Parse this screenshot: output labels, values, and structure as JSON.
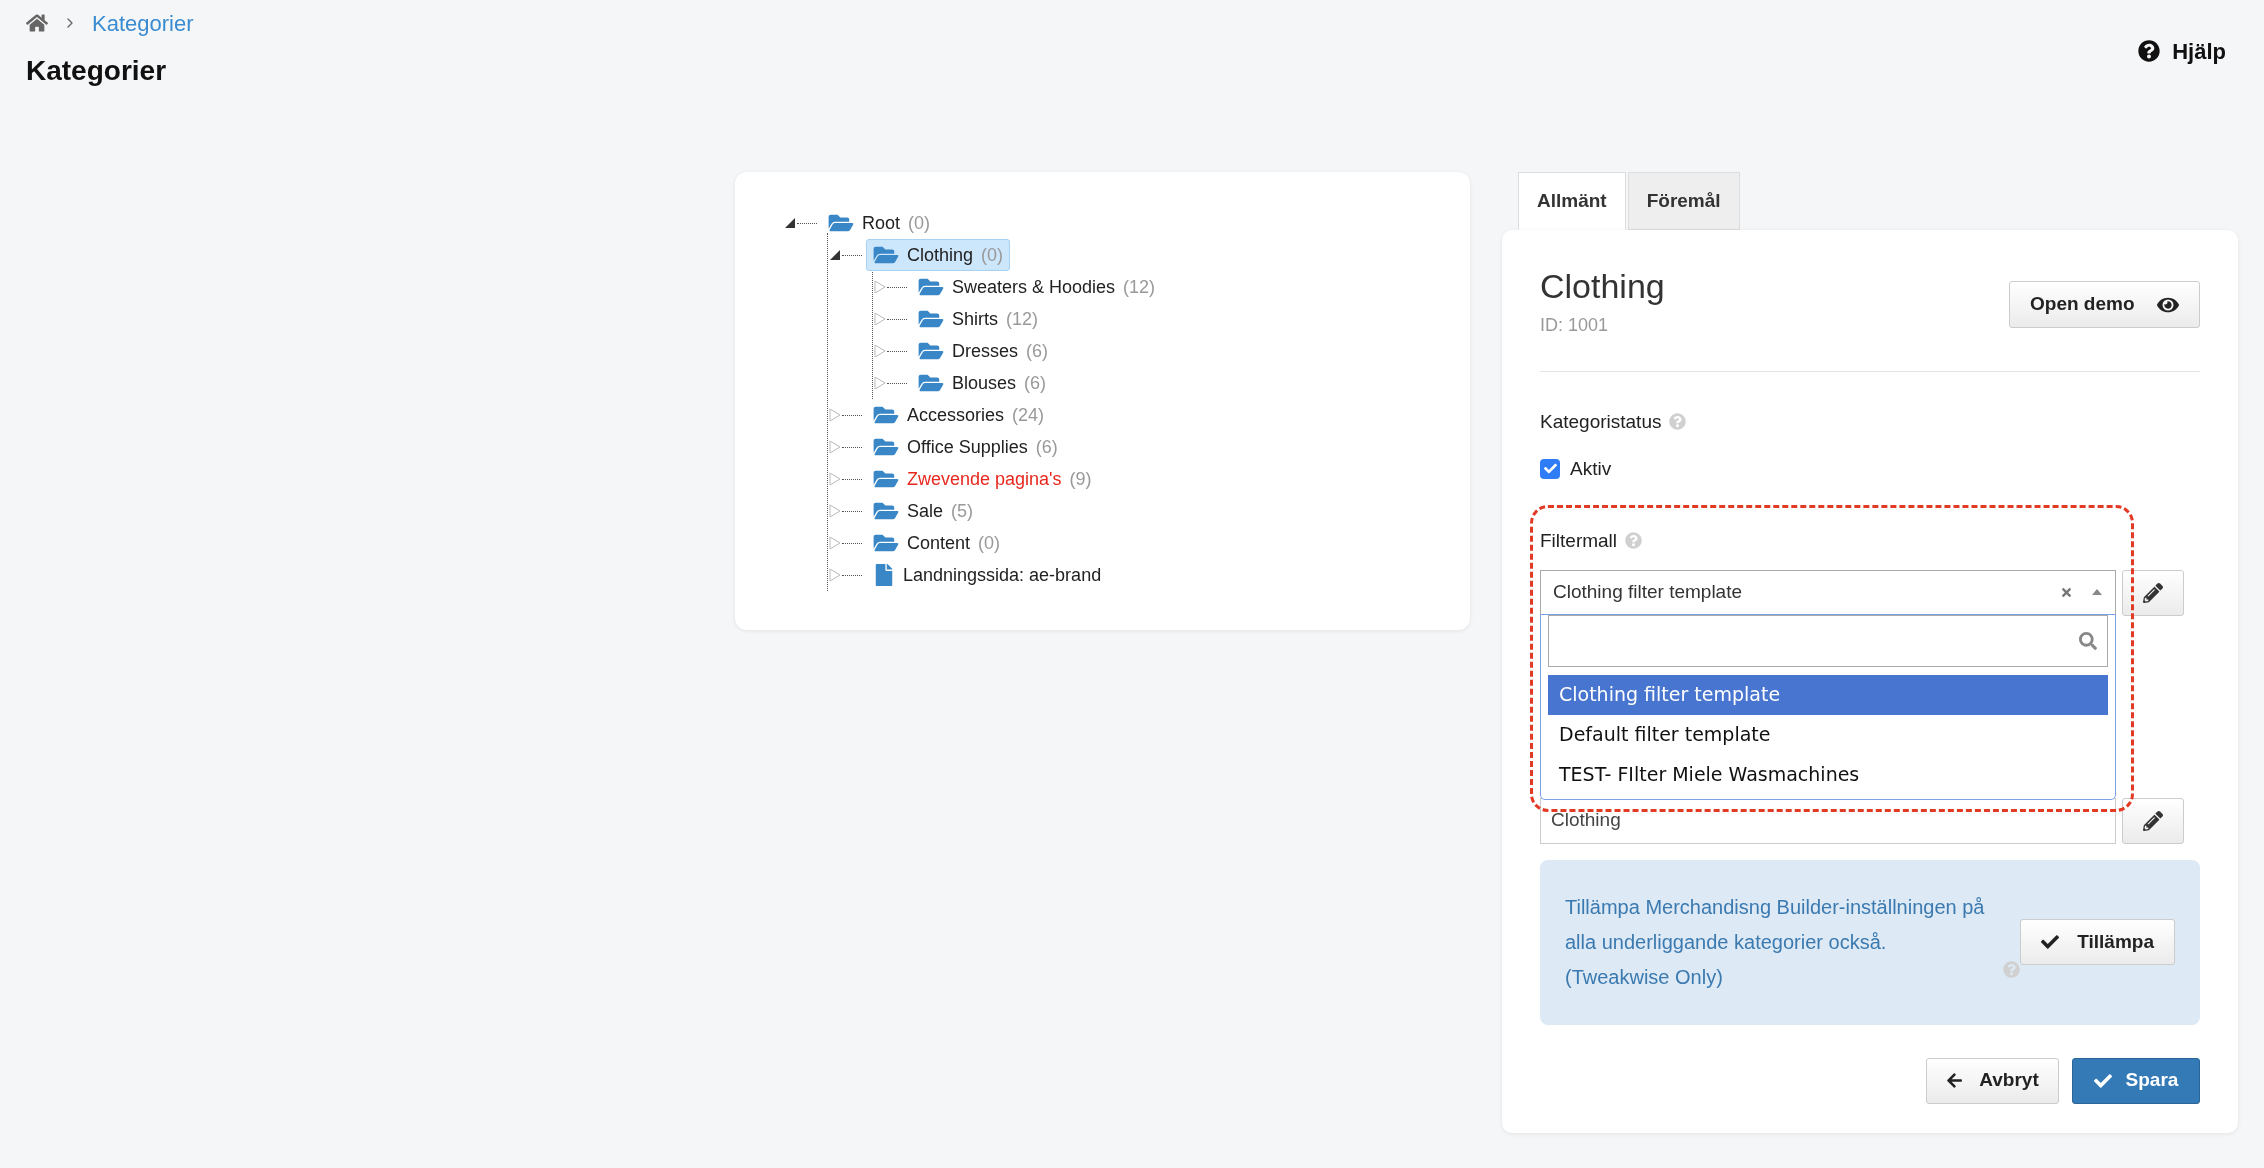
{
  "breadcrumb": [
    {
      "label": "Kategorier"
    }
  ],
  "page_title": "Kategorier",
  "help": "Hjälp",
  "tree": {
    "label": "Root",
    "count": "(0)",
    "kind": "folder",
    "expanded": true,
    "selected": false,
    "flagged": false,
    "children": [
      {
        "label": "Clothing",
        "count": "(0)",
        "kind": "folder",
        "expanded": true,
        "selected": true,
        "flagged": false,
        "children": [
          {
            "label": "Sweaters & Hoodies",
            "count": "(12)",
            "kind": "folder",
            "expanded": false,
            "selected": false,
            "flagged": false
          },
          {
            "label": "Shirts",
            "count": "(12)",
            "kind": "folder",
            "expanded": false,
            "selected": false,
            "flagged": false
          },
          {
            "label": "Dresses",
            "count": "(6)",
            "kind": "folder",
            "expanded": false,
            "selected": false,
            "flagged": false
          },
          {
            "label": "Blouses",
            "count": "(6)",
            "kind": "folder",
            "expanded": false,
            "selected": false,
            "flagged": false
          }
        ]
      },
      {
        "label": "Accessories",
        "count": "(24)",
        "kind": "folder",
        "expanded": false,
        "selected": false,
        "flagged": false
      },
      {
        "label": "Office Supplies",
        "count": "(6)",
        "kind": "folder",
        "expanded": false,
        "selected": false,
        "flagged": false
      },
      {
        "label": "Zwevende pagina's",
        "count": "(9)",
        "kind": "folder",
        "expanded": false,
        "selected": false,
        "flagged": true
      },
      {
        "label": "Sale",
        "count": "(5)",
        "kind": "folder",
        "expanded": false,
        "selected": false,
        "flagged": false
      },
      {
        "label": "Content",
        "count": "(0)",
        "kind": "folder",
        "expanded": false,
        "selected": false,
        "flagged": false
      },
      {
        "label": "Landningssida: ae-brand",
        "kind": "page",
        "expanded": false,
        "selected": false,
        "flagged": false
      }
    ]
  },
  "tabs": [
    {
      "label": "Allmänt",
      "selected": true
    },
    {
      "label": "Föremål",
      "selected": false
    }
  ],
  "detail": {
    "title": "Clothing",
    "id_text": "ID: 1001",
    "open_demo": "Open demo",
    "status_label": "Kategoristatus",
    "active": {
      "label": "Aktiv",
      "checked": true
    },
    "filter_label": "Filtermall",
    "filter_select": {
      "value": "Clothing filter template",
      "open": true
    },
    "options": [
      {
        "label": "Clothing filter template",
        "selected": true
      },
      {
        "label": "Default filter template",
        "selected": false
      },
      {
        "label": "TEST- FIlter Miele Wasmachines",
        "selected": false
      }
    ],
    "merch_select": {
      "value": "Clothing"
    },
    "info": {
      "text": "Tillämpa Merchandisng Builder-inställningen på alla underliggande kategorier också. (Tweakwise Only)",
      "button": "Tillämpa"
    },
    "cancel": "Avbryt",
    "save": "Spara"
  }
}
